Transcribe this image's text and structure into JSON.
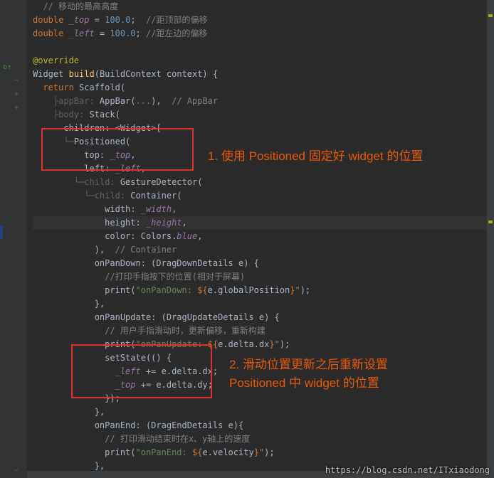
{
  "gutter": {
    "override_icon": "o↑",
    "fold_plus": "+",
    "fold_minus": "−",
    "run_icon": "▶"
  },
  "code": {
    "l0_partial": "  // 移动的最高高度",
    "l1_kw": "double",
    "l1_var": "_top",
    "l1_eq": " = ",
    "l1_num": "100.0",
    "l1_end": ";  ",
    "l1_comment": "//距顶部的偏移",
    "l2_kw": "double",
    "l2_var": "_left",
    "l2_eq": " = ",
    "l2_num": "100.0",
    "l2_end": "; ",
    "l2_comment": "//距左边的偏移",
    "l4_override": "@override",
    "l5_type": "Widget",
    "l5_method": "build",
    "l5_sig": "(BuildContext context) {",
    "l6_return": "return",
    "l6_scaffold": " Scaffold(",
    "l7_pre": "    ├appBar: ",
    "l7_appbar": "AppBar",
    "l7_paren": "(",
    "l7_dots": "...",
    "l7_close": "),",
    "l7_comment": "  // AppBar",
    "l8_pre": "    ├body: ",
    "l8_call": "Stack(",
    "l9_pre": "      children: ",
    "l9_lt": "<",
    "l9_widget": "Widget",
    "l9_gt": ">[",
    "l10_pre": "      └─",
    "l10_call": "Positioned(",
    "l11_pre": "          top: ",
    "l11_var": "_top",
    "l11_end": ",",
    "l12_pre": "          left: ",
    "l12_var": "_left",
    "l12_end": ",",
    "l13_pre": "        └─child: ",
    "l13_call": "GestureDetector(",
    "l14_pre": "          └─child: ",
    "l14_call": "Container(",
    "l15_pre": "              width: ",
    "l15_var": "_width",
    "l15_end": ",",
    "l16_pre": "              height: ",
    "l16_var": "_height",
    "l16_end": ",",
    "l17_pre": "              color: Colors.",
    "l17_blue": "blue",
    "l17_end": ",",
    "l18_pre": "            ),",
    "l18_comment": "  // Container",
    "l19_pre": "            onPanDown: (DragDownDetails e) {",
    "l20_comment": "              //打印手指按下的位置(相对于屏幕)",
    "l21_pre": "              print(",
    "l21_str1": "\"onPanDown: ",
    "l21_dollar": "${",
    "l21_expr": "e.globalPosition",
    "l21_close": "}\"",
    "l21_end": ");",
    "l22_pre": "            },",
    "l23_pre": "            onPanUpdate: (DragUpdateDetails e) {",
    "l24_comment": "              // 用户手指滑动时，更新偏移，重新构建",
    "l25_pre": "              print(",
    "l25_str1": "\"onPanUpdate: ",
    "l25_dollar": "${",
    "l25_expr": "e.delta.dx",
    "l25_close": "}\"",
    "l25_end": ");",
    "l26_pre": "              setState(() {",
    "l27_pre": "                ",
    "l27_var": "_left",
    "l27_op": " += e.delta.dx;",
    "l28_pre": "                ",
    "l28_var": "_top",
    "l28_op": " += e.delta.dy;",
    "l29_pre": "              });",
    "l30_pre": "            },",
    "l31_pre": "            onPanEnd: (DragEndDetails e){",
    "l32_comment": "              // 打印滑动结束时在x、y轴上的速度",
    "l33_pre": "              print(",
    "l33_str1": "\"onPanEnd: ",
    "l33_dollar": "${",
    "l33_expr": "e.velocity",
    "l33_close": "}\"",
    "l33_end": ");",
    "l34_pre": "            },"
  },
  "annotations": {
    "anno1": "1. 使用 Positioned 固定好 widget 的位置",
    "anno2_l1": "2. 滑动位置更新之后重新设置",
    "anno2_l2": "Positioned 中 widget 的位置"
  },
  "watermark": "https://blog.csdn.net/ITxiaodong"
}
